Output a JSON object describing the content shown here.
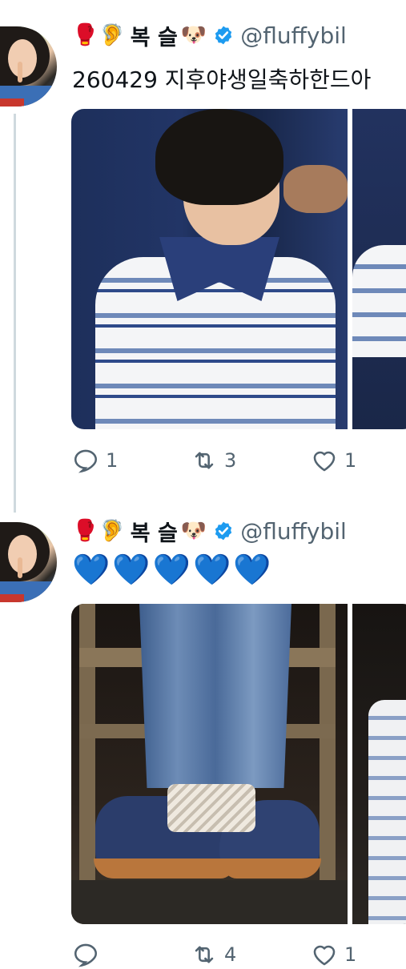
{
  "tweets": [
    {
      "display_name": "복 슬",
      "name_emojis_before": [
        "🥊",
        "🦻"
      ],
      "name_emoji_after": "🐶",
      "handle": "@fluffybil",
      "text": "260429 지후야생일축하한드아",
      "actions": {
        "replies": "1",
        "retweets": "3",
        "likes": "1"
      }
    },
    {
      "display_name": "복 슬",
      "name_emojis_before": [
        "🥊",
        "🦻"
      ],
      "name_emoji_after": "🐶",
      "handle": "@fluffybil",
      "hearts": [
        "💙",
        "💙",
        "💙",
        "💙",
        "💙"
      ],
      "actions": {
        "replies": "",
        "retweets": "4",
        "likes": "1"
      }
    }
  ],
  "icons": {
    "verified": "verified-badge-icon",
    "reply": "speech-bubble-icon",
    "retweet": "retweet-arrows-icon",
    "like": "heart-outline-icon"
  },
  "colors": {
    "verified": "#1d9bf0",
    "muted": "#536471",
    "thread_line": "#cfd9de",
    "blue_heart": "#1e6fe8"
  }
}
